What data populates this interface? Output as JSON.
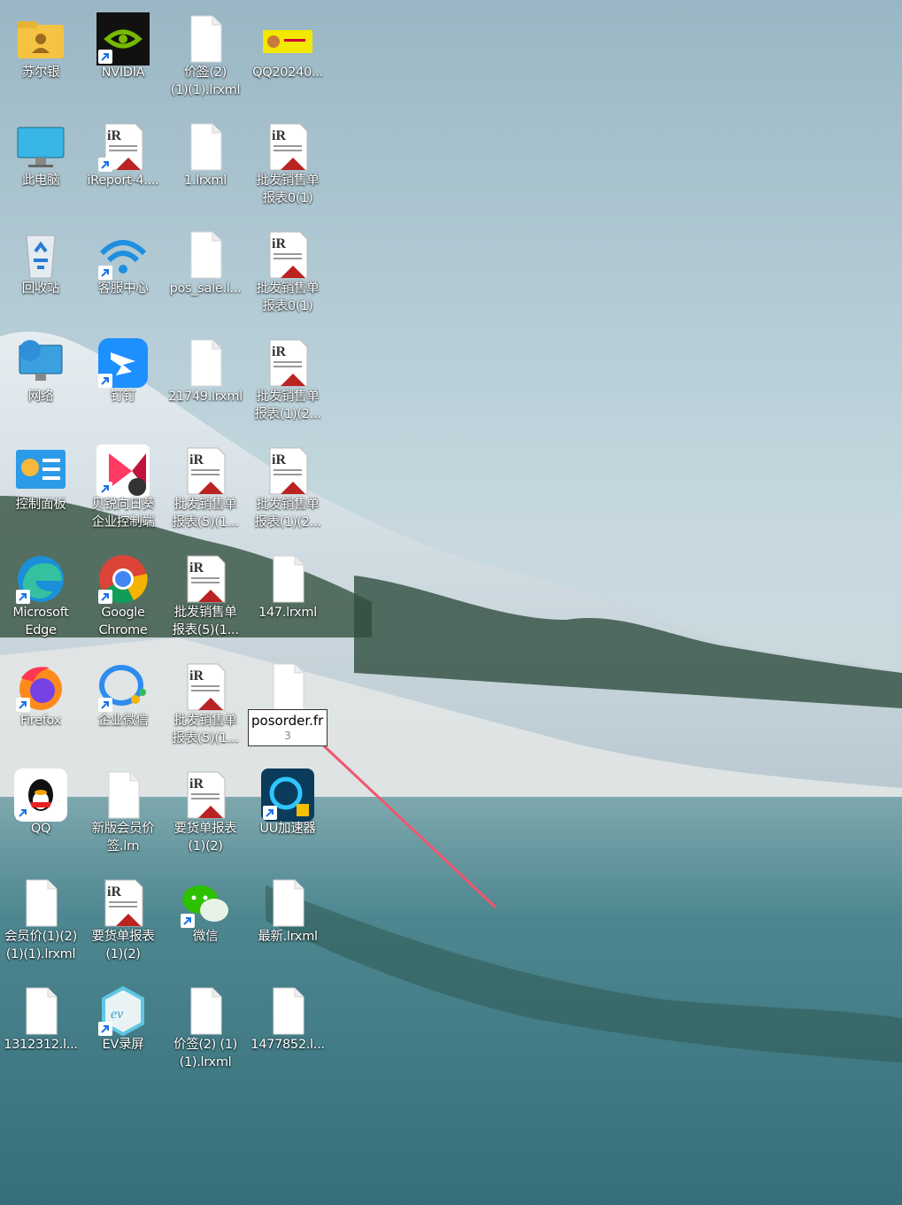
{
  "desktop": {
    "icons": [
      {
        "label": "苏尔银",
        "kind": "folder-user"
      },
      {
        "label": "NVIDIA",
        "kind": "nvidia"
      },
      {
        "label": "价签(2)\n(1)(1).lrxml",
        "kind": "doc"
      },
      {
        "label": "QQ20240...",
        "kind": "image-thumb"
      },
      {
        "label": "此电脑",
        "kind": "monitor"
      },
      {
        "label": "iReport-4....",
        "kind": "ireport"
      },
      {
        "label": "1.lrxml",
        "kind": "doc"
      },
      {
        "label": "批发销售单\n报表0(1)",
        "kind": "ireport"
      },
      {
        "label": "回收站",
        "kind": "recycle-bin"
      },
      {
        "label": "客服中心",
        "kind": "support"
      },
      {
        "label": "pos_sale.l...",
        "kind": "doc"
      },
      {
        "label": "批发销售单\n报表0(1)",
        "kind": "ireport"
      },
      {
        "label": "网络",
        "kind": "network"
      },
      {
        "label": "钉钉",
        "kind": "dingtalk"
      },
      {
        "label": "21749.lrxml",
        "kind": "doc"
      },
      {
        "label": "批发销售单\n报表(1)(2...",
        "kind": "ireport"
      },
      {
        "label": "控制面板",
        "kind": "control-panel"
      },
      {
        "label": "贝锐向日葵\n企业控制端",
        "kind": "sunflower"
      },
      {
        "label": "批发销售单\n报表(5)(1...",
        "kind": "ireport"
      },
      {
        "label": "批发销售单\n报表(1)(2...",
        "kind": "ireport"
      },
      {
        "label": "Microsoft\nEdge",
        "kind": "edge"
      },
      {
        "label": "Google\nChrome",
        "kind": "chrome"
      },
      {
        "label": "批发销售单\n报表(5)(1...",
        "kind": "ireport"
      },
      {
        "label": "147.lrxml",
        "kind": "doc"
      },
      {
        "label": "Firefox",
        "kind": "firefox"
      },
      {
        "label": "企业微信",
        "kind": "wecom"
      },
      {
        "label": "批发销售单\n报表(5)(1...",
        "kind": "ireport"
      },
      {
        "label": "",
        "kind": "doc-renaming"
      },
      {
        "label": "QQ",
        "kind": "qq"
      },
      {
        "label": "新版会员价\n签.lrn",
        "kind": "doc"
      },
      {
        "label": "要货单报表\n(1)(2)",
        "kind": "ireport"
      },
      {
        "label": "UU加速器",
        "kind": "uu"
      },
      {
        "label": "会员价(1)(2)\n(1)(1).lrxml",
        "kind": "doc"
      },
      {
        "label": "要货单报表\n(1)(2)",
        "kind": "ireport"
      },
      {
        "label": "微信",
        "kind": "wechat"
      },
      {
        "label": "最新.lrxml",
        "kind": "doc"
      },
      {
        "label": "1312312.l...",
        "kind": "doc"
      },
      {
        "label": "EV录屏",
        "kind": "ev"
      },
      {
        "label": "价签(2) (1)\n(1).lrxml",
        "kind": "doc"
      },
      {
        "label": "1477852.l...",
        "kind": "doc"
      }
    ],
    "rename_box": {
      "value": "posorder.fr",
      "overflow": "3"
    },
    "annotation_arrow_color": "#f0566e"
  }
}
